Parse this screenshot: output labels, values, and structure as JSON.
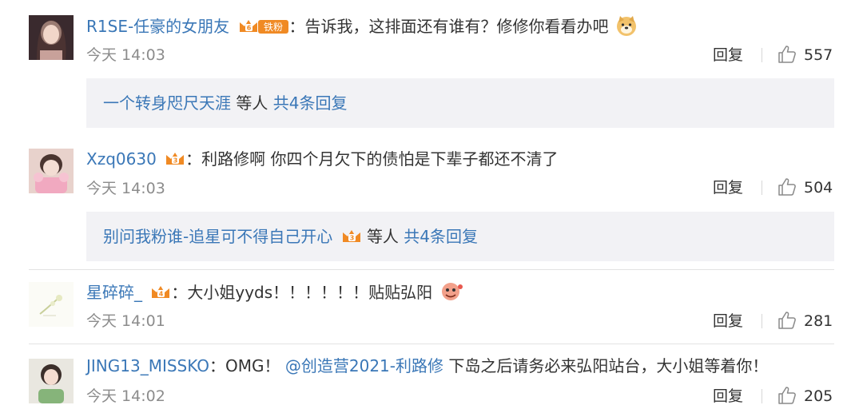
{
  "comments": [
    {
      "username": "R1SE-任豪的女朋友",
      "text": "告诉我，这排面还有谁有？修修你看看办吧",
      "time": "今天 14:03",
      "reply_label": "回复",
      "likes": "557",
      "badge_label": "铁粉",
      "emoji": "doge-emoji",
      "sub_replies": {
        "name": "一个转身咫尺天涯",
        "middle": "等人",
        "count_link": "共4条回复"
      }
    },
    {
      "username": "Xzq0630",
      "text": "利路修啊 你四个月欠下的债怕是下辈子都还不清了",
      "time": "今天 14:03",
      "reply_label": "回复",
      "likes": "504",
      "sub_replies": {
        "name": "别问我粉谁-追星可不得自己开心",
        "middle": "等人",
        "count_link": "共4条回复"
      }
    },
    {
      "username": "星碎碎_",
      "text": "大小姐yyds！！！！！！贴贴弘阳",
      "time": "今天 14:01",
      "reply_label": "回复",
      "likes": "281",
      "emoji": "cartoon-emoji"
    },
    {
      "username": "JING13_MISSKO",
      "text_prefix": "OMG！",
      "mention": "@创造营2021-利路修",
      "text_suffix": " 下岛之后请务必来弘阳站台，大小姐等着你！",
      "time": "今天 14:02",
      "reply_label": "回复",
      "likes": "205"
    }
  ],
  "colors": {
    "link": "#3a77b7",
    "time": "#8c8c8c",
    "sub_bg": "#f2f2f5",
    "badge": "#f08a24"
  },
  "icons": [
    "thumbs-up-icon",
    "vip-crown-badge-icon"
  ]
}
